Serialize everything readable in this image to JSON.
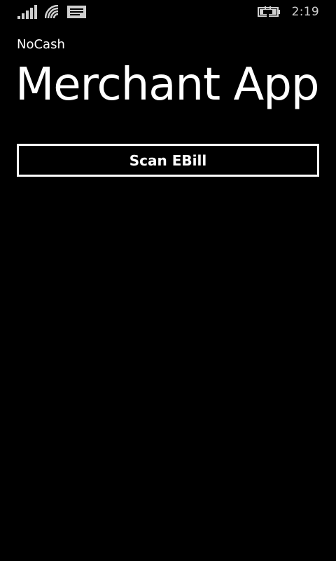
{
  "status_bar": {
    "icons": [
      "signal-strength-icon",
      "wifi-icon",
      "message-icon",
      "battery-charging-icon"
    ],
    "time": "2:19"
  },
  "header": {
    "app_name": "NoCash",
    "page_title": "Merchant App"
  },
  "main": {
    "scan_button_label": "Scan EBill"
  },
  "colors": {
    "background": "#000000",
    "foreground": "#ffffff",
    "status_text": "#cfcfcf"
  }
}
